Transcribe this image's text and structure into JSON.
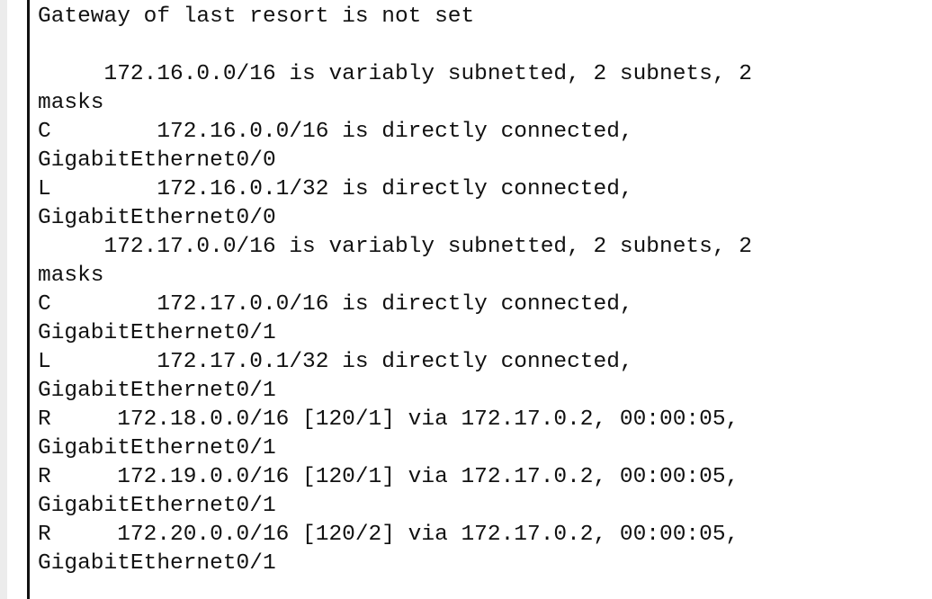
{
  "console": {
    "lines": [
      "Gateway of last resort is not set",
      "",
      "     172.16.0.0/16 is variably subnetted, 2 subnets, 2",
      "masks",
      "C        172.16.0.0/16 is directly connected,",
      "GigabitEthernet0/0",
      "L        172.16.0.1/32 is directly connected,",
      "GigabitEthernet0/0",
      "     172.17.0.0/16 is variably subnetted, 2 subnets, 2",
      "masks",
      "C        172.17.0.0/16 is directly connected,",
      "GigabitEthernet0/1",
      "L        172.17.0.1/32 is directly connected,",
      "GigabitEthernet0/1",
      "R     172.18.0.0/16 [120/1] via 172.17.0.2, 00:00:05,",
      "GigabitEthernet0/1",
      "R     172.19.0.0/16 [120/1] via 172.17.0.2, 00:00:05,",
      "GigabitEthernet0/1",
      "R     172.20.0.0/16 [120/2] via 172.17.0.2, 00:00:05,",
      "GigabitEthernet0/1"
    ]
  }
}
